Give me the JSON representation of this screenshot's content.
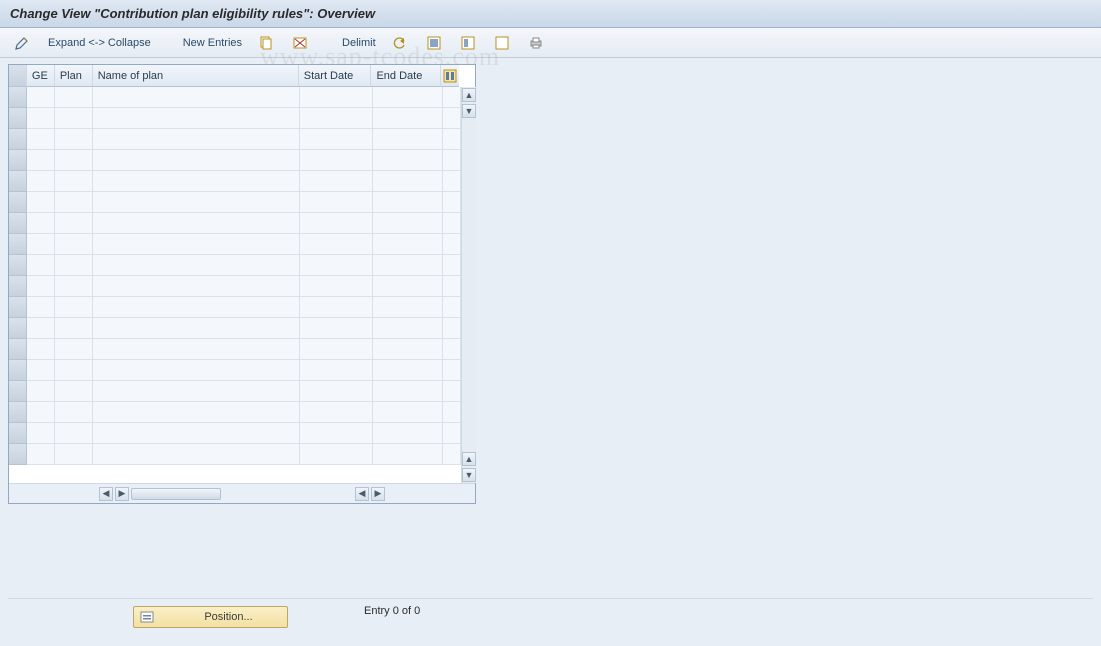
{
  "title": "Change View \"Contribution plan eligibility rules\": Overview",
  "toolbar": {
    "expand_collapse": "Expand <-> Collapse",
    "new_entries": "New Entries",
    "delimit": "Delimit"
  },
  "columns": {
    "ge": "GE",
    "plan": "Plan",
    "name": "Name of plan",
    "start": "Start Date",
    "end": "End Date"
  },
  "rows": [
    {
      "ge": "",
      "plan": "",
      "name": "",
      "start": "",
      "end": ""
    },
    {
      "ge": "",
      "plan": "",
      "name": "",
      "start": "",
      "end": ""
    },
    {
      "ge": "",
      "plan": "",
      "name": "",
      "start": "",
      "end": ""
    },
    {
      "ge": "",
      "plan": "",
      "name": "",
      "start": "",
      "end": ""
    },
    {
      "ge": "",
      "plan": "",
      "name": "",
      "start": "",
      "end": ""
    },
    {
      "ge": "",
      "plan": "",
      "name": "",
      "start": "",
      "end": ""
    },
    {
      "ge": "",
      "plan": "",
      "name": "",
      "start": "",
      "end": ""
    },
    {
      "ge": "",
      "plan": "",
      "name": "",
      "start": "",
      "end": ""
    },
    {
      "ge": "",
      "plan": "",
      "name": "",
      "start": "",
      "end": ""
    },
    {
      "ge": "",
      "plan": "",
      "name": "",
      "start": "",
      "end": ""
    },
    {
      "ge": "",
      "plan": "",
      "name": "",
      "start": "",
      "end": ""
    },
    {
      "ge": "",
      "plan": "",
      "name": "",
      "start": "",
      "end": ""
    },
    {
      "ge": "",
      "plan": "",
      "name": "",
      "start": "",
      "end": ""
    },
    {
      "ge": "",
      "plan": "",
      "name": "",
      "start": "",
      "end": ""
    },
    {
      "ge": "",
      "plan": "",
      "name": "",
      "start": "",
      "end": ""
    },
    {
      "ge": "",
      "plan": "",
      "name": "",
      "start": "",
      "end": ""
    },
    {
      "ge": "",
      "plan": "",
      "name": "",
      "start": "",
      "end": ""
    },
    {
      "ge": "",
      "plan": "",
      "name": "",
      "start": "",
      "end": ""
    }
  ],
  "position_button": "Position...",
  "entry_status": "Entry 0 of 0",
  "watermark": "www.sap-tcodes.com"
}
